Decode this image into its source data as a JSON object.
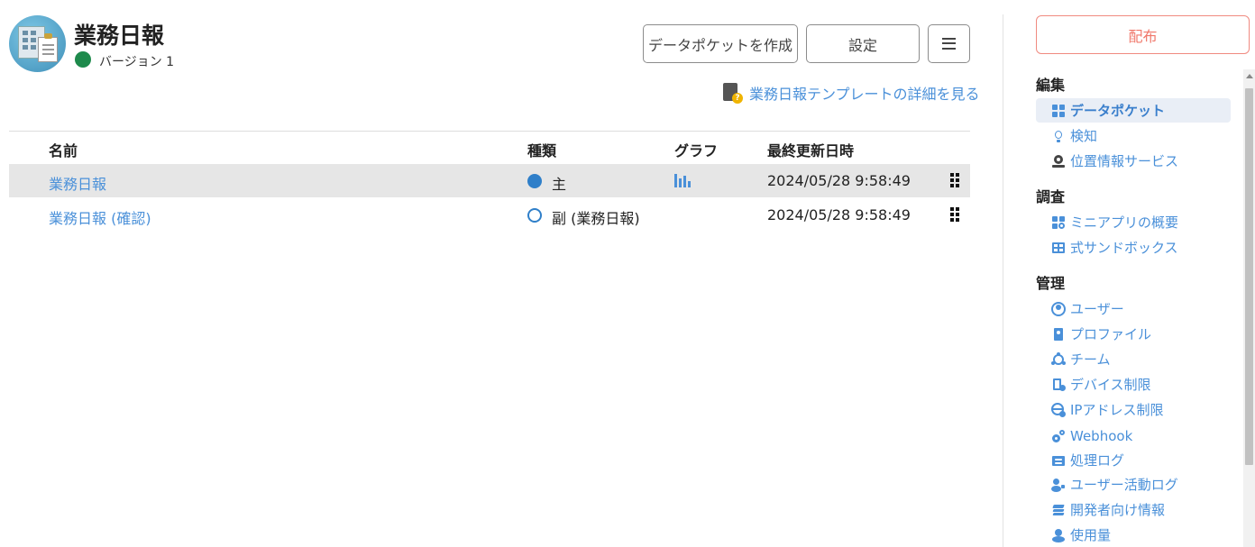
{
  "header": {
    "app_title": "業務日報",
    "version_label": "バージョン 1",
    "version_status_color": "#1e8a4c",
    "buttons": {
      "create_datapocket": "データポケットを作成",
      "settings": "設定",
      "menu_icon": "hamburger-icon"
    },
    "template_link": "業務日報テンプレートの詳細を見る"
  },
  "table": {
    "columns": [
      "名前",
      "種類",
      "グラフ",
      "最終更新日時"
    ],
    "rows": [
      {
        "name": "業務日報",
        "type": "主",
        "type_marker": "filled",
        "has_graph": true,
        "updated": "2024/05/28 9:58:49",
        "selected": true
      },
      {
        "name": "業務日報 (確認)",
        "type": "副 (業務日報)",
        "type_marker": "ring",
        "has_graph": false,
        "updated": "2024/05/28 9:58:49",
        "selected": false
      }
    ]
  },
  "sidebar": {
    "distribute_button": "配布",
    "sections": [
      {
        "heading": "編集",
        "items": [
          {
            "label": "データポケット",
            "icon": "grid-icon",
            "active": true
          },
          {
            "label": "検知",
            "icon": "lightbulb-icon",
            "active": false
          },
          {
            "label": "位置情報サービス",
            "icon": "map-pin-icon",
            "active": false
          }
        ]
      },
      {
        "heading": "調査",
        "items": [
          {
            "label": "ミニアプリの概要",
            "icon": "grid-search-icon",
            "active": false
          },
          {
            "label": "式サンドボックス",
            "icon": "table-icon",
            "active": false
          }
        ]
      },
      {
        "heading": "管理",
        "items": [
          {
            "label": "ユーザー",
            "icon": "user-circle-icon",
            "active": false
          },
          {
            "label": "プロファイル",
            "icon": "id-badge-icon",
            "active": false
          },
          {
            "label": "チーム",
            "icon": "team-icon",
            "active": false
          },
          {
            "label": "デバイス制限",
            "icon": "device-check-icon",
            "active": false
          },
          {
            "label": "IPアドレス制限",
            "icon": "globe-icon",
            "active": false
          },
          {
            "label": "Webhook",
            "icon": "gears-icon",
            "active": false
          },
          {
            "label": "処理ログ",
            "icon": "log-icon",
            "active": false
          },
          {
            "label": "ユーザー活動ログ",
            "icon": "user-activity-icon",
            "active": false
          },
          {
            "label": "開発者向け情報",
            "icon": "layers-icon",
            "active": false
          },
          {
            "label": "使用量",
            "icon": "usage-icon",
            "active": false
          }
        ]
      }
    ]
  },
  "colors": {
    "link": "#4a90d9",
    "accent_blue": "#2f7fc9",
    "distribute": "#f0786b",
    "selected_row": "#e6e6e6"
  }
}
